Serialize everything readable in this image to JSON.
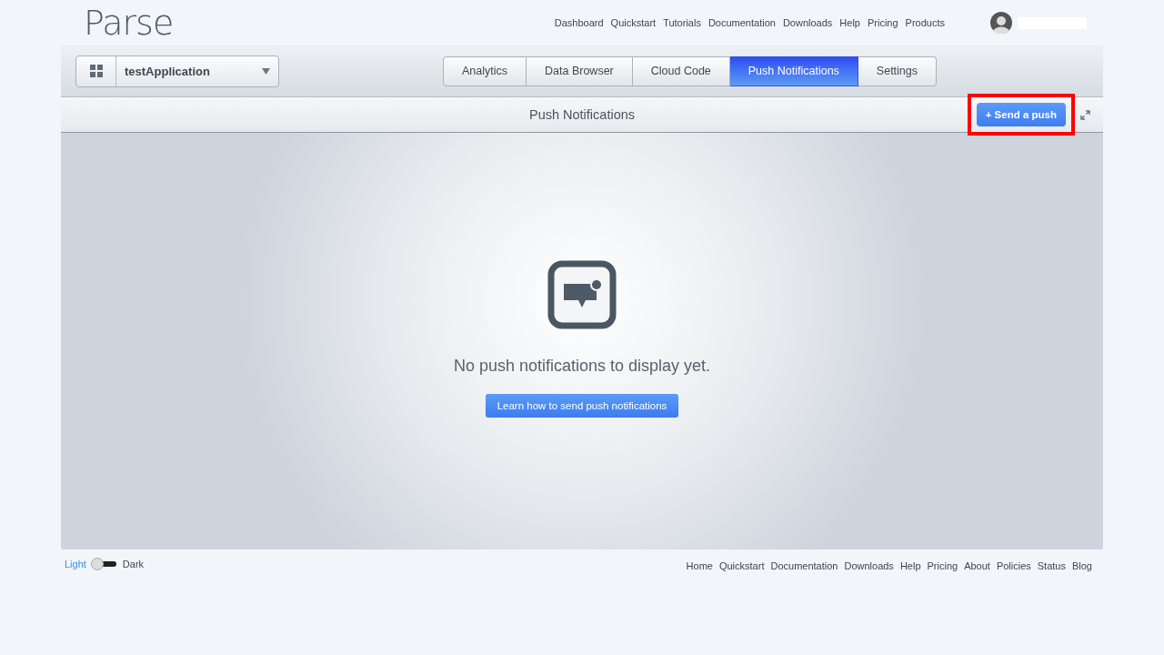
{
  "logo": "Parse",
  "top_nav": [
    "Dashboard",
    "Quickstart",
    "Tutorials",
    "Documentation",
    "Downloads",
    "Help",
    "Pricing",
    "Products"
  ],
  "app_selector": {
    "value": "testApplication"
  },
  "tabs": [
    {
      "label": "Analytics",
      "selected": false
    },
    {
      "label": "Data Browser",
      "selected": false
    },
    {
      "label": "Cloud Code",
      "selected": false
    },
    {
      "label": "Push Notifications",
      "selected": true
    },
    {
      "label": "Settings",
      "selected": false
    }
  ],
  "page_title": "Push Notifications",
  "send_button": {
    "label": "+ Send a push",
    "highlighted": true
  },
  "empty_state": {
    "message": "No push notifications to display yet.",
    "button": "Learn how to send push notifications"
  },
  "theme_options": [
    {
      "label": "Light",
      "selected": true
    },
    {
      "label": "Dark",
      "selected": false
    }
  ],
  "footer_nav": [
    "Home",
    "Quickstart",
    "Documentation",
    "Downloads",
    "Help",
    "Pricing",
    "About",
    "Policies",
    "Status",
    "Blog"
  ]
}
